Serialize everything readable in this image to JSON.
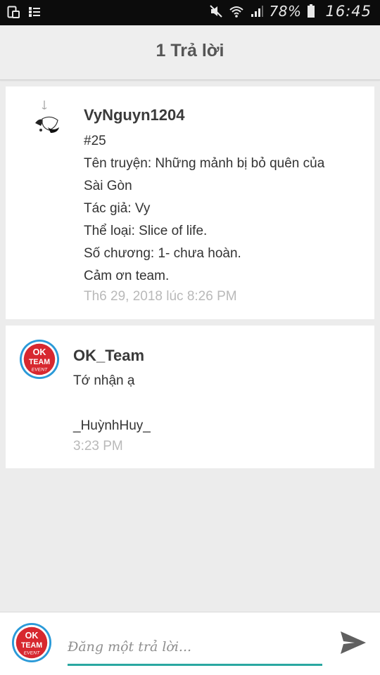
{
  "status_bar": {
    "battery_percent": "78%",
    "time": "16:45",
    "icons": [
      "screenshot-icon",
      "gallery-icon",
      "mute-icon",
      "wifi-icon",
      "signal-icon",
      "battery-icon"
    ]
  },
  "header": {
    "title": "1 Trả lời"
  },
  "posts": [
    {
      "username": "VyNguyn1204",
      "lines": [
        "#25",
        "Tên truyện: Những mảnh bị bỏ quên của",
        "Sài Gòn",
        "Tác giả: Vy",
        "Thể loại: Slice of life.",
        "Số chương: 1- chưa hoàn.",
        "Cảm ơn team."
      ],
      "timestamp": "Th6 29, 2018 lúc 8:26 PM"
    },
    {
      "username": "OK_Team",
      "lines": [
        "Tớ nhận ạ",
        "",
        "_HuỳnhHuy_"
      ],
      "timestamp": "3:23 PM"
    }
  ],
  "avatar_logo": {
    "line1": "OK",
    "line2": "TEAM",
    "line3": "EVENT"
  },
  "reply": {
    "placeholder": "Đăng một trả lời..."
  },
  "colors": {
    "accent": "#2aa7a1",
    "logo_red": "#d7282f",
    "logo_ring": "#2b9ad8"
  }
}
